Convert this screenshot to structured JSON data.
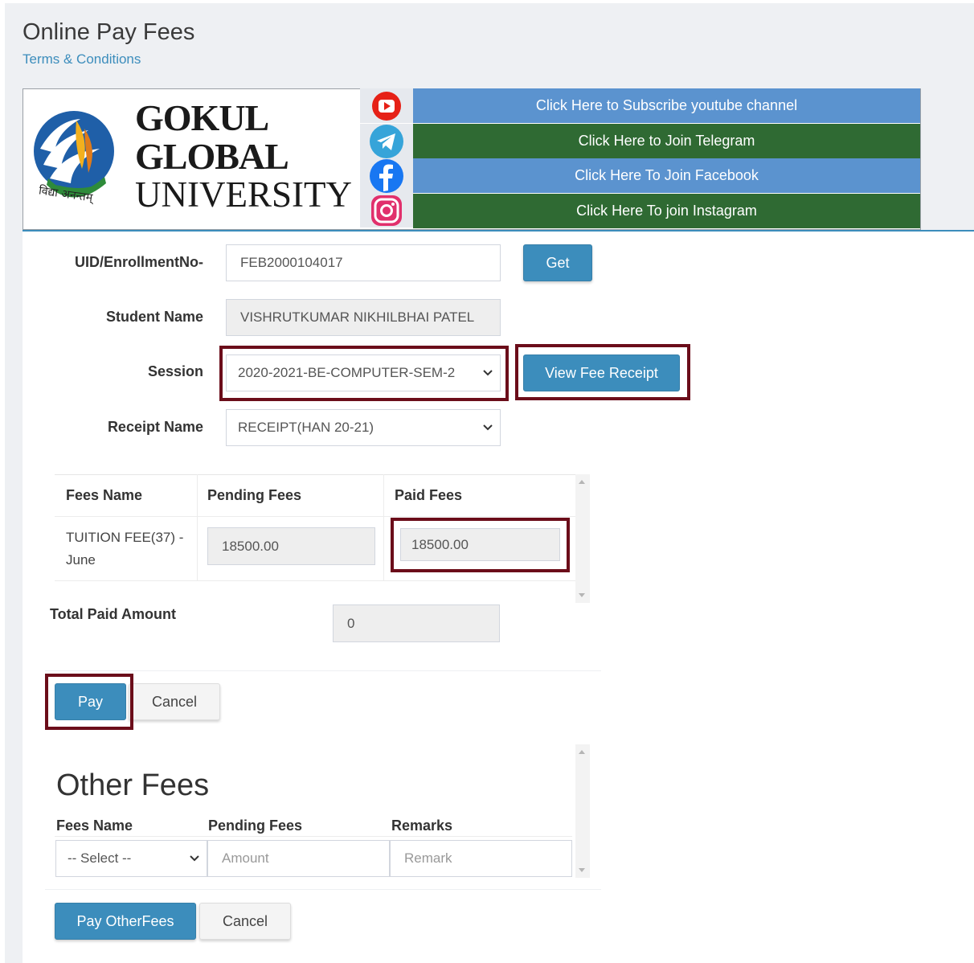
{
  "page": {
    "title": "Online Pay Fees",
    "terms_link": "Terms & Conditions"
  },
  "banner": {
    "university_line1": "GOKUL",
    "university_line2": "GLOBAL",
    "university_line3": "UNIVERSITY",
    "logo_motto": "विद्या अनन्तम्",
    "social": [
      {
        "icon": "youtube-icon",
        "label": "Click Here to Subscribe youtube channel",
        "color": "#5b93cf"
      },
      {
        "icon": "telegram-icon",
        "label": "Click Here to Join Telegram",
        "color": "#2f6a33"
      },
      {
        "icon": "facebook-icon",
        "label": "Click Here To Join Facebook",
        "color": "#5b93cf"
      },
      {
        "icon": "instagram-icon",
        "label": "Click Here To join Instagram",
        "color": "#2f6a33"
      }
    ]
  },
  "form": {
    "uid_label": "UID/EnrollmentNo-",
    "uid_value": "FEB2000104017",
    "get_button": "Get",
    "student_name_label": "Student Name",
    "student_name_value": "VISHRUTKUMAR NIKHILBHAI PATEL",
    "session_label": "Session",
    "session_value": "2020-2021-BE-COMPUTER-SEM-2",
    "view_receipt_button": "View Fee Receipt",
    "receipt_name_label": "Receipt Name",
    "receipt_name_value": "RECEIPT(HAN 20-21)"
  },
  "fees_table": {
    "headers": [
      "Fees Name",
      "Pending Fees",
      "Paid Fees"
    ],
    "rows": [
      {
        "fees_name": "TUITION FEE(37) - June",
        "pending": "18500.00",
        "paid": "18500.00"
      }
    ]
  },
  "total": {
    "label": "Total Paid Amount",
    "value": "0"
  },
  "actions": {
    "pay": "Pay",
    "cancel": "Cancel"
  },
  "other_fees": {
    "title": "Other Fees",
    "headers": [
      "Fees Name",
      "Pending Fees",
      "Remarks"
    ],
    "select_value": "-- Select --",
    "amount_placeholder": "Amount",
    "remark_placeholder": "Remark",
    "pay_button": "Pay OtherFees",
    "cancel_button": "Cancel"
  },
  "colors": {
    "accent": "#3c8dbc",
    "highlight": "#6b0d1a",
    "social_blue": "#5b93cf",
    "social_green": "#2f6a33"
  }
}
